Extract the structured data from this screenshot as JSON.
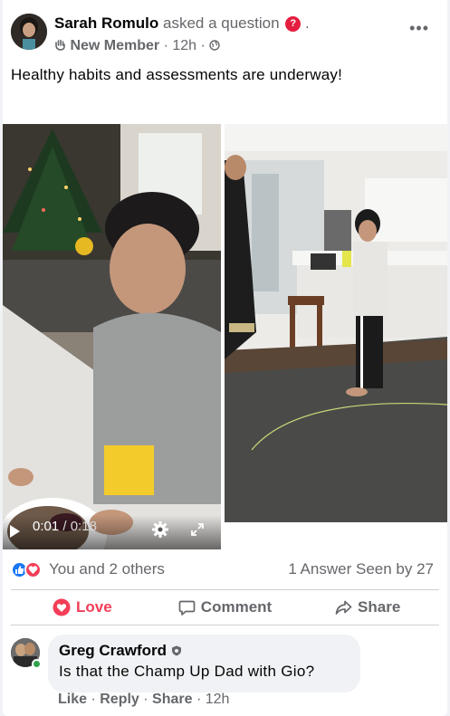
{
  "post": {
    "author": "Sarah Romulo",
    "action": "asked a question",
    "question_badge": "?",
    "member_label": "New Member",
    "sep1": " · ",
    "time": "12h",
    "sep2": " · ",
    "more_label": "•••",
    "text": "Healthy habits and assessments are underway!"
  },
  "video": {
    "current_time": "0:01",
    "duration": "0:18",
    "time_sep": " / "
  },
  "reactions": {
    "summary": "You and 2 others",
    "answers": "1 Answer",
    "seen": "Seen by 27",
    "icons": [
      "like-icon",
      "love-icon"
    ],
    "like_color": "#1877f2",
    "love_color": "#f33e58"
  },
  "actions": {
    "love": "Love",
    "comment": "Comment",
    "share": "Share"
  },
  "comment": {
    "author": "Greg Crawford",
    "text": "Is that the Champ Up Dad with Gio?",
    "like": "Like",
    "reply": "Reply",
    "share": "Share",
    "time": "12h",
    "sep": " · "
  }
}
